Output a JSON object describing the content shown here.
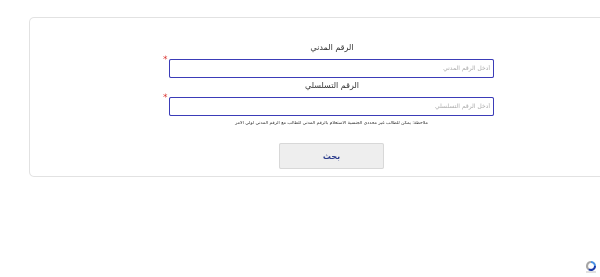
{
  "form": {
    "civil_id_label": "الرقم المدني",
    "civil_id_placeholder": "أدخل الرقم المدني",
    "civil_id_value": "",
    "serial_label": "الرقم التسلسلي",
    "serial_placeholder": "أدخل الرقم التسلسلي",
    "serial_value": "",
    "required_mark": "*",
    "note": "ملاحظة: يمكن للطالب غير محددي الجنسية الاستعلام بالرقم المدني للطالب مع الرقم المدني لولي الأمر",
    "search_label": "بحث"
  },
  "icons": {
    "corner": "recaptcha-icon"
  },
  "colors": {
    "input_border": "#3b3cb8",
    "required": "#d9302c",
    "button_text": "#2b3c8c",
    "button_bg": "#eeeeee"
  }
}
